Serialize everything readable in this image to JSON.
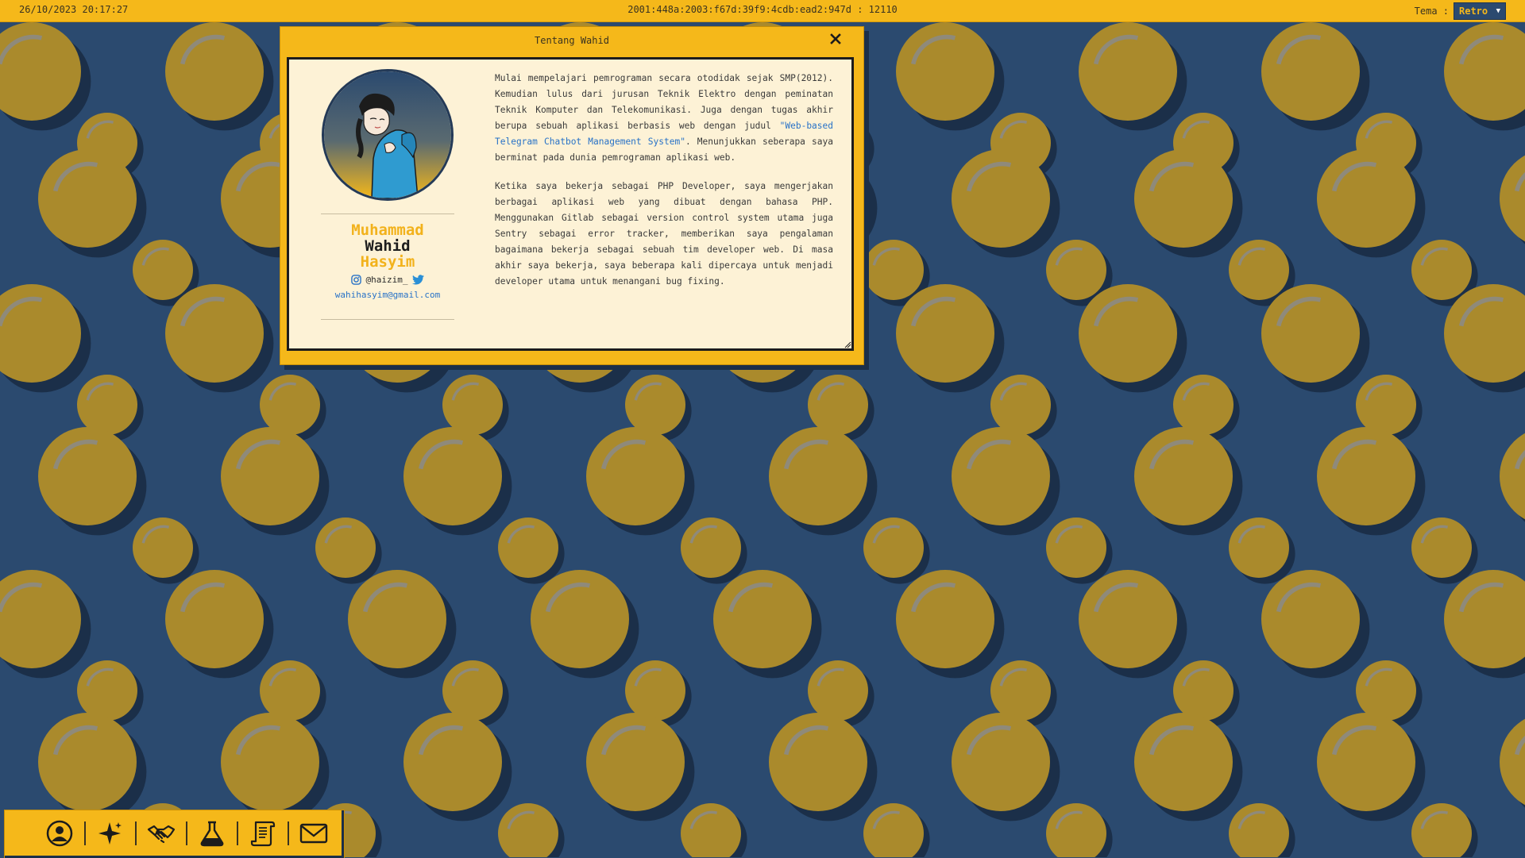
{
  "topbar": {
    "datetime": "26/10/2023 20:17:27",
    "address": "2001:448a:2003:f67d:39f9:4cdb:ead2:947d : 12110",
    "theme_label": "Tema :",
    "theme_value": "Retro"
  },
  "window": {
    "title": "Tentang Wahid",
    "profile": {
      "first_name": "Muhammad",
      "middle_name": "Wahid",
      "last_name": "Hasyim",
      "instagram_handle": "@haizim_",
      "email": "wahihasyim@gmail.com"
    },
    "bio": {
      "p1_before": "Mulai mempelajari pemrograman secara otodidak sejak SMP(2012). Kemudian lulus dari jurusan Teknik Elektro dengan peminatan Teknik Komputer dan Telekomunikasi. Juga dengan tugas akhir berupa sebuah aplikasi berbasis web dengan judul ",
      "p1_link": "\"Web-based Telegram Chatbot Management System\"",
      "p1_after": ". Menunjukkan seberapa saya berminat pada dunia pemrograman aplikasi web.",
      "p2": "Ketika saya bekerja sebagai PHP Developer, saya mengerjakan berbagai aplikasi web yang dibuat dengan bahasa PHP. Menggunakan Gitlab sebagai version control system utama juga Sentry sebagai error tracker, memberikan saya pengalaman bagaimana bekerja sebagai sebuah tim developer web. Di masa akhir saya bekerja, saya beberapa kali dipercaya untuk menjadi developer utama untuk menangani bug fixing."
    }
  },
  "dock": {
    "items": [
      "profile-icon",
      "sparkle-icon",
      "handshake-icon",
      "flask-icon",
      "scroll-icon",
      "mail-icon"
    ]
  },
  "colors": {
    "accent": "#f5b81a",
    "background": "#2b4a6f",
    "link": "#2872c7",
    "panel": "#fdf2d6"
  }
}
